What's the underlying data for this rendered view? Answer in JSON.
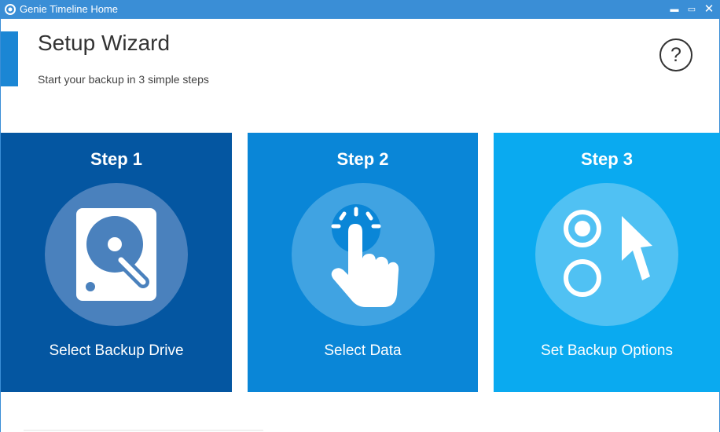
{
  "window": {
    "title": "Genie Timeline Home",
    "minimize_glyph": "▬",
    "maximize_glyph": "▭",
    "close_glyph": "✕"
  },
  "header": {
    "title": "Setup Wizard",
    "subtitle": "Start your backup in 3 simple steps",
    "help_glyph": "?"
  },
  "steps": [
    {
      "title": "Step 1",
      "label": "Select Backup Drive",
      "icon": "hard-drive-icon",
      "color": "#0456a1"
    },
    {
      "title": "Step 2",
      "label": "Select Data",
      "icon": "tap-hand-icon",
      "color": "#0a86d7"
    },
    {
      "title": "Step 3",
      "label": "Set Backup Options",
      "icon": "options-cursor-icon",
      "color": "#0aaaf0"
    }
  ],
  "colors": {
    "titlebar": "#3a8ed6",
    "accent": "#1b86d4"
  }
}
